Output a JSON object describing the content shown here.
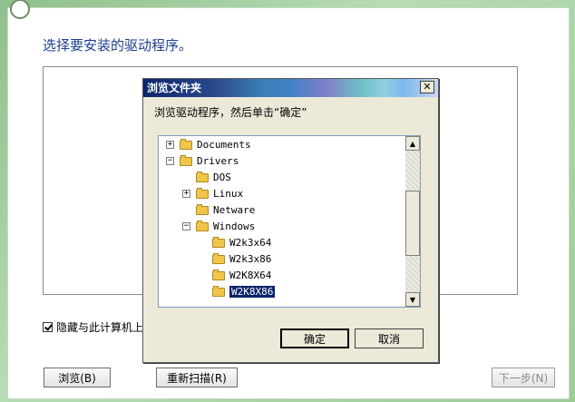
{
  "wizard": {
    "heading": "选择要安装的驱动程序。",
    "hide_checkbox_label": "隐藏与此计算机上",
    "browse_label": "浏览(B)",
    "rescan_label": "重新扫描(R)",
    "next_label": "下一步(N)"
  },
  "dialog": {
    "title": "浏览文件夹",
    "close_symbol": "✕",
    "instruction": "浏览驱动程序，然后单击“确定”",
    "tree": [
      {
        "label": "Documents",
        "expander": "+",
        "level": 0
      },
      {
        "label": "Drivers",
        "expander": "−",
        "level": 0
      },
      {
        "label": "DOS",
        "expander": "",
        "level": 1
      },
      {
        "label": "Linux",
        "expander": "+",
        "level": 1
      },
      {
        "label": "Netware",
        "expander": "",
        "level": 1
      },
      {
        "label": "Windows",
        "expander": "−",
        "level": 1
      },
      {
        "label": "W2k3x64",
        "expander": "",
        "level": 2
      },
      {
        "label": "W2k3x86",
        "expander": "",
        "level": 2
      },
      {
        "label": "W2K8X64",
        "expander": "",
        "level": 2
      },
      {
        "label": "W2K8X86",
        "expander": "",
        "level": 2,
        "selected": true
      }
    ],
    "ok_label": "确定",
    "cancel_label": "取消"
  }
}
